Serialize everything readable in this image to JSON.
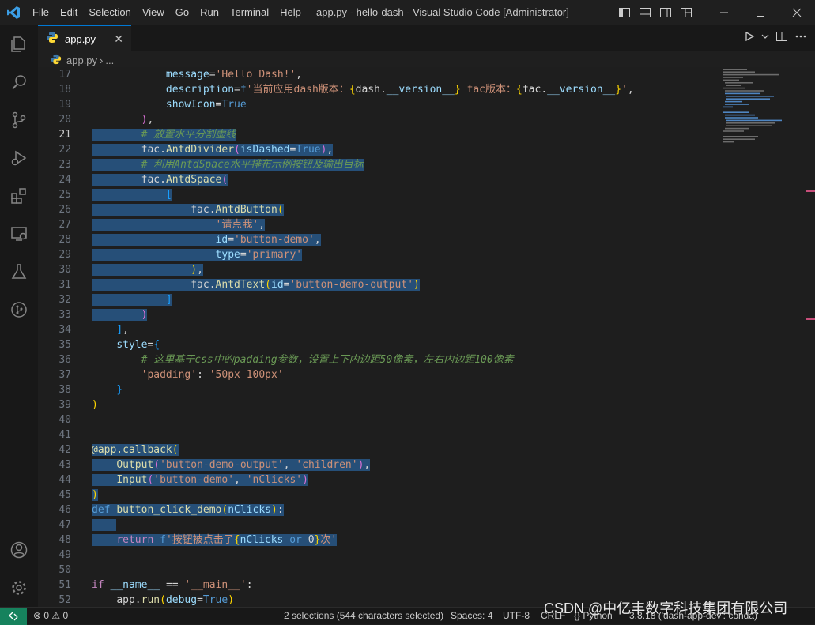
{
  "window": {
    "title": "app.py - hello-dash - Visual Studio Code [Administrator]",
    "menu": [
      "File",
      "Edit",
      "Selection",
      "View",
      "Go",
      "Run",
      "Terminal",
      "Help"
    ],
    "controls": {
      "minimize": "—",
      "maximize": "☐",
      "close": "✕"
    }
  },
  "activity_bar": {
    "items": [
      "explorer-icon",
      "search-icon",
      "source-control-icon",
      "run-debug-icon",
      "extensions-icon",
      "remote-explorer-icon",
      "testing-icon",
      "git-graph-icon"
    ],
    "bottom": [
      "accounts-icon",
      "settings-gear-icon"
    ]
  },
  "tab": {
    "label": "app.py",
    "close": "✕"
  },
  "breadcrumb": {
    "file": "app.py",
    "sep": "›",
    "rest": "..."
  },
  "editor": {
    "current_line": 21,
    "line_numbers": [
      17,
      18,
      19,
      20,
      21,
      22,
      23,
      24,
      25,
      26,
      27,
      28,
      29,
      30,
      31,
      32,
      33,
      34,
      35,
      36,
      37,
      38,
      39,
      40,
      41,
      42,
      43,
      44,
      45,
      46,
      47,
      48,
      49,
      50,
      51,
      52
    ]
  },
  "status_bar": {
    "remote": "⨯",
    "problems": "⊗ 0 ⚠ 0",
    "selection": "2 selections (544 characters selected)",
    "spaces": "Spaces: 4",
    "encoding": "UTF-8",
    "eol": "CRLF",
    "language": "Python",
    "interpreter": "3.8.18 ('dash-app-dev': conda)",
    "accent": "#16825d"
  },
  "watermark": "CSDN @中亿丰数字科技集团有限公司",
  "colors": {
    "selection": "#264f78",
    "keyword": "#569cd6",
    "string": "#ce9178",
    "comment": "#6a9955",
    "function": "#dcdcaa"
  }
}
